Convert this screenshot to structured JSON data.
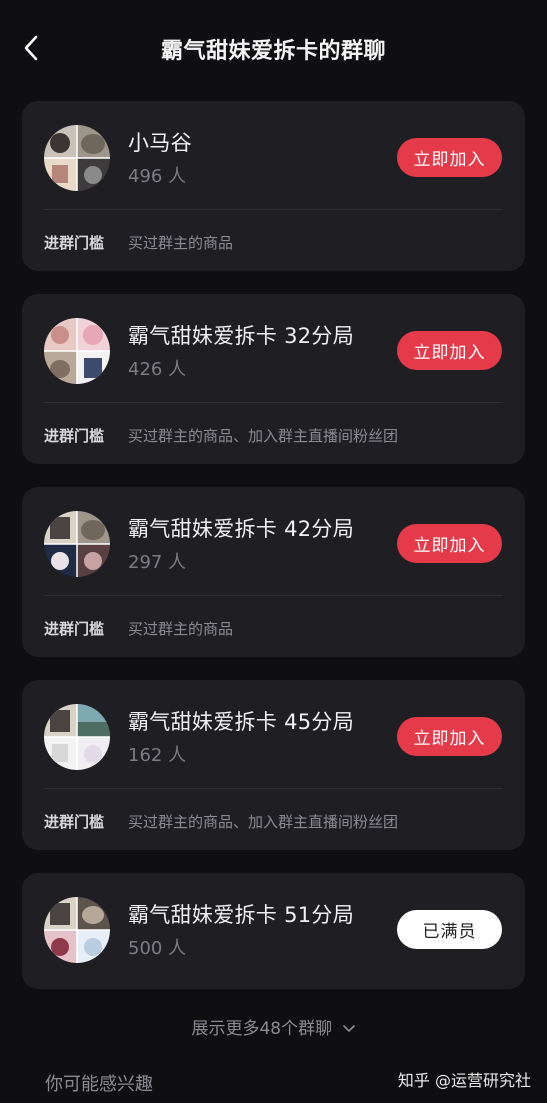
{
  "header": {
    "title": "霸气甜妹爱拆卡的群聊"
  },
  "groups": [
    {
      "name": "小马谷",
      "members": "496 人",
      "action": "立即加入",
      "threshold_label": "进群门槛",
      "threshold": "买过群主的商品"
    },
    {
      "name": "霸气甜妹爱拆卡 32分局",
      "members": "426 人",
      "action": "立即加入",
      "threshold_label": "进群门槛",
      "threshold": "买过群主的商品、加入群主直播间粉丝团"
    },
    {
      "name": "霸气甜妹爱拆卡 42分局",
      "members": "297 人",
      "action": "立即加入",
      "threshold_label": "进群门槛",
      "threshold": "买过群主的商品"
    },
    {
      "name": "霸气甜妹爱拆卡 45分局",
      "members": "162 人",
      "action": "立即加入",
      "threshold_label": "进群门槛",
      "threshold": "买过群主的商品、加入群主直播间粉丝团"
    },
    {
      "name": "霸气甜妹爱拆卡 51分局",
      "members": "500 人",
      "action": "已满员"
    }
  ],
  "footer": {
    "show_more": "展示更多48个群聊",
    "maybe_interested": "你可能感兴趣",
    "watermark": "知乎 @运营研究社"
  },
  "colors": {
    "background": "#0f0f11",
    "card": "#1f1f23",
    "join_button": "#e53a4a",
    "full_button": "#ffffff"
  },
  "icons": {
    "back": "chevron-left-icon",
    "expand": "chevron-down-icon"
  }
}
